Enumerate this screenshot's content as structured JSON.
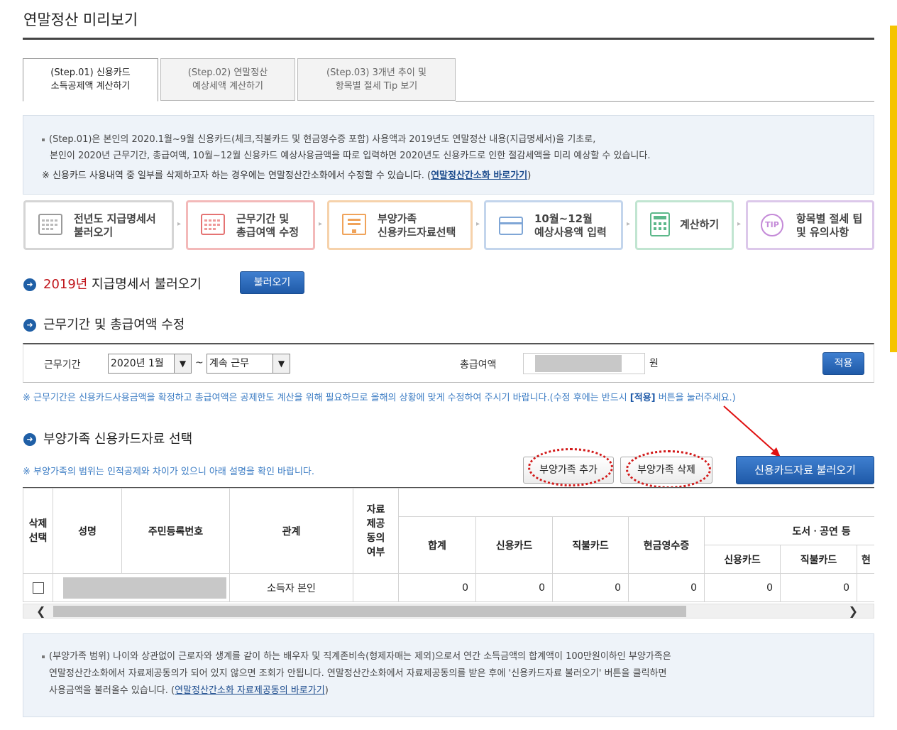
{
  "page": {
    "title": "연말정산 미리보기"
  },
  "tabs": [
    {
      "line1": "(Step.01) 신용카드",
      "line2": "소득공제액 계산하기"
    },
    {
      "line1": "(Step.02) 연말정산",
      "line2": "예상세액 계산하기"
    },
    {
      "line1": "(Step.03) 3개년 추이 및",
      "line2": "항목별 절세 Tip 보기"
    }
  ],
  "intro": {
    "line1": "(Step.01)은 본인의 2020.1월~9월 신용카드(체크,직불카드 및 현금영수증 포함) 사용액과 2019년도 연말정산 내용(지급명세서)을 기초로,",
    "line2": "본인이 2020년 근무기간, 총급여액, 10월~12월 신용카드 예상사용금액을 따로 입력하면 2020년도 신용카드로 인한 절감세액을 미리 예상할 수 있습니다.",
    "line3_prefix": "※ 신용카드 사용내역 중 일부를 삭제하고자 하는 경우에는 연말정산간소화에서 수정할 수 있습니다. (",
    "line3_link": "연말정산간소화 바로가기",
    "line3_suffix": ")"
  },
  "steps": [
    {
      "line1": "전년도 지급명세서",
      "line2": "불러오기",
      "icon": "calendar-icon",
      "color": "#cccccc"
    },
    {
      "line1": "근무기간 및",
      "line2": "총급여액 수정",
      "icon": "calendar-red-icon",
      "color": "#f2b6b6"
    },
    {
      "line1": "부양가족",
      "line2": "신용카드자료선택",
      "icon": "monitor-icon",
      "color": "#f5cfa6"
    },
    {
      "line1": "10월~12월",
      "line2": "예상사용액 입력",
      "icon": "card-icon",
      "color": "#bfd2ea"
    },
    {
      "line1": "계산하기",
      "line2": "",
      "icon": "calculator-icon",
      "color": "#bfe3cf"
    },
    {
      "line1": "항목별 절세 팁",
      "line2": "및 유의사항",
      "icon": "tip-icon",
      "color": "#dcc6e8"
    }
  ],
  "section1": {
    "year": "2019년",
    "title": "지급명세서 불러오기",
    "button": "불러오기"
  },
  "section2": {
    "title": "근무기간 및 총급여액 수정",
    "period_label": "근무기간",
    "start_value": "2020년 1월",
    "tilde": "~",
    "end_value": "계속 근무",
    "salary_label": "총급여액",
    "salary_unit": "원",
    "apply_button": "적용",
    "note_prefix": "※ 근무기간은 신용카드사용금액을 확정하고 총급여액은 공제한도 계산을 위해 필요하므로 올해의 상황에 맞게 수정하여 주시기 바랍니다.(수정 후에는 반드시 ",
    "note_bold": "[적용]",
    "note_suffix": " 버튼을 눌러주세요.)"
  },
  "section3": {
    "title": "부양가족 신용카드자료 선택",
    "note": "※ 부양가족의 범위는 인적공제와 차이가 있으니 아래 설명을 확인 바랍니다.",
    "add_button": "부양가족 추가",
    "delete_button": "부양가족 삭제",
    "load_button": "신용카드자료 불러오기"
  },
  "table": {
    "headers": {
      "select": [
        "삭제",
        "선택"
      ],
      "name": "성명",
      "rrn": "주민등록번호",
      "relation": "관계",
      "consent": [
        "자료",
        "제공",
        "동의",
        "여부"
      ],
      "total": "합계",
      "credit": "신용카드",
      "debit": "직불카드",
      "cash": "현금영수증",
      "books_group": "도서ㆍ공연 등",
      "books_credit": "신용카드",
      "books_debit": "직불카드",
      "books_cash": "현"
    },
    "row": {
      "relation": "소득자 본인",
      "total": "0",
      "credit": "0",
      "debit": "0",
      "cash": "0",
      "books_credit": "0",
      "books_debit": "0"
    }
  },
  "scroll": {
    "left": "❮",
    "right": "❯"
  },
  "bottom": {
    "line1": "(부양가족 범위) 나이와 상관없이 근로자와 생계를 같이 하는 배우자 및 직계존비속(형제자매는 제외)으로서 연간 소득금액의 합계액이 100만원이하인 부양가족은",
    "line2": "연말정산간소화에서 자료제공동의가 되어 있지 않으면 조회가 안됩니다. 연말정산간소화에서 자료제공동의를 받은 후에 '신용카드자료 불러오기' 버튼을 클릭하면",
    "line3_prefix": "사용금액을 불러올수 있습니다. (",
    "line3_link": "연말정산간소화 자료제공동의 바로가기",
    "line3_suffix": ")"
  }
}
